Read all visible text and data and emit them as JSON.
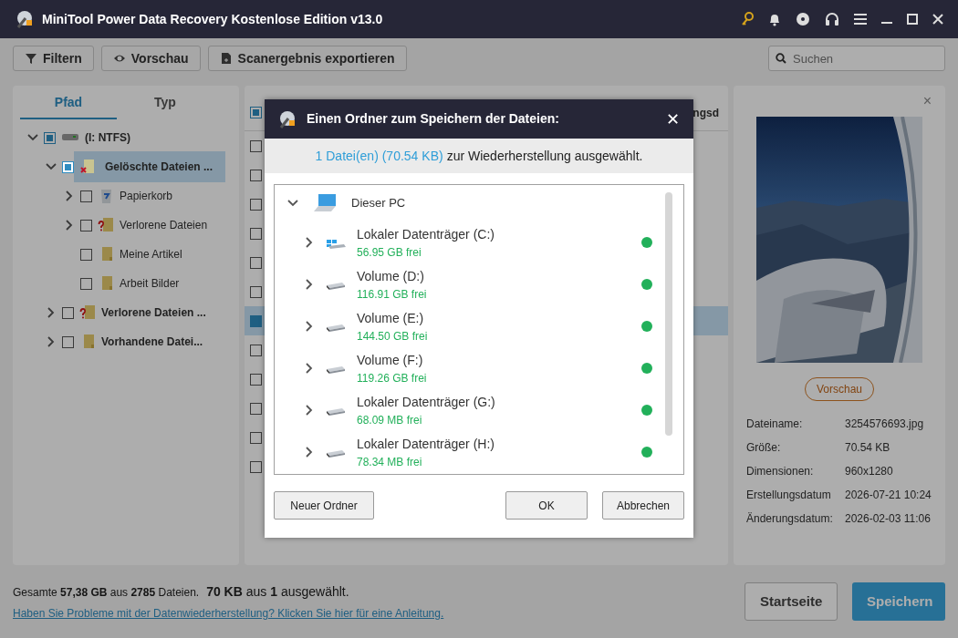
{
  "window": {
    "title": "MiniTool Power Data Recovery Kostenlose Edition v13.0"
  },
  "toolbar": {
    "buttons": [
      {
        "label": "Filtern",
        "kind": "filter"
      },
      {
        "label": "Vorschau",
        "kind": "eye"
      },
      {
        "label": "Scanergebnis exportieren",
        "kind": "export"
      }
    ],
    "search": {
      "placeholder": "Suchen"
    }
  },
  "tabs": [
    {
      "label": "Pfad",
      "selected": true
    },
    {
      "label": "Typ",
      "selected": false
    }
  ],
  "tree": [
    {
      "label": "(I: NTFS)",
      "kind": "drive",
      "checked": false,
      "partial": true,
      "selected": false,
      "expanded": true,
      "children": [
        {
          "label": "Gelöschte Dateien ...",
          "kind": "deleted",
          "checked": false,
          "partial": true,
          "selected": true,
          "expanded": true,
          "children": [
            {
              "label": "Papierkorb",
              "kind": "recycle",
              "checked": false,
              "partial": false,
              "selected": false,
              "expanded": false
            },
            {
              "label": "Verlorene Dateien",
              "kind": "lost",
              "checked": false,
              "partial": false,
              "selected": false,
              "expanded": false
            },
            {
              "label": "Meine Artikel",
              "kind": "folder",
              "checked": false,
              "partial": false,
              "selected": false
            },
            {
              "label": "Arbeit Bilder",
              "kind": "folder",
              "checked": false,
              "partial": false,
              "selected": false
            }
          ]
        },
        {
          "label": "Verlorene Dateien ...",
          "kind": "lost",
          "checked": false,
          "partial": false,
          "selected": false,
          "expanded": false
        },
        {
          "label": "Vorhandene Datei...",
          "kind": "folder",
          "checked": false,
          "partial": false,
          "selected": false,
          "expanded": false
        }
      ]
    }
  ],
  "file_list": {
    "header": {
      "checked": false,
      "partial": true,
      "column_label": "ngsd"
    },
    "rows": [
      {
        "checked": false,
        "selected": false
      },
      {
        "checked": false,
        "selected": false
      },
      {
        "checked": false,
        "selected": false
      },
      {
        "checked": false,
        "selected": false
      },
      {
        "checked": false,
        "selected": false
      },
      {
        "checked": false,
        "selected": false
      },
      {
        "checked": true,
        "selected": true
      },
      {
        "checked": false,
        "selected": false
      },
      {
        "checked": false,
        "selected": false
      },
      {
        "checked": false,
        "selected": false
      },
      {
        "checked": false,
        "selected": false
      },
      {
        "checked": false,
        "selected": false
      }
    ]
  },
  "preview": {
    "close": "×",
    "button": "Vorschau",
    "details": [
      {
        "label": "Dateiname:",
        "value": "3254576693.jpg"
      },
      {
        "label": "Größe:",
        "value": "70.54 KB"
      },
      {
        "label": "Dimensionen:",
        "value": "960x1280"
      },
      {
        "label": "Erstellungsdatum",
        "value": "2026-07-21 10:24"
      },
      {
        "label": "Änderungsdatum:",
        "value": "2026-02-03 11:06"
      }
    ]
  },
  "footer": {
    "summary": "Gesamte **57,38 GB** aus **2785** Dateien.",
    "selection": "**70 KB** aus **1** ausgewählt.",
    "help_link": "Haben Sie Probleme mit der Datenwiederherstellung? Klicken Sie hier für eine Anleitung.",
    "buttons": [
      {
        "label": "Startseite",
        "kind": "secondary"
      },
      {
        "label": "Speichern",
        "kind": "primary"
      }
    ]
  },
  "dialog": {
    "title": "Einen Ordner zum Speichern der Dateien:",
    "close": "✕",
    "count": "1 Datei(en) (70.54 KB)",
    "message": "zur Wiederherstellung ausgewählt.",
    "root": {
      "label": "Dieser PC",
      "expanded": true
    },
    "drives": [
      {
        "name": "Lokaler Datenträger (C:)",
        "free": "56.95 GB frei",
        "kind": "system",
        "expanded": false,
        "color": "#22b05a"
      },
      {
        "name": "Volume (D:)",
        "free": "116.91 GB frei",
        "kind": "disk",
        "expanded": false,
        "color": "#22b05a"
      },
      {
        "name": "Volume (E:)",
        "free": "144.50 GB frei",
        "kind": "disk",
        "expanded": false,
        "color": "#22b05a"
      },
      {
        "name": "Volume (F:)",
        "free": "119.26 GB frei",
        "kind": "disk",
        "expanded": false,
        "color": "#22b05a"
      },
      {
        "name": "Lokaler Datenträger (G:)",
        "free": "68.09 MB frei",
        "kind": "disk",
        "expanded": false,
        "color": "#22b05a"
      },
      {
        "name": "Lokaler Datenträger (H:)",
        "free": "78.34 MB frei",
        "kind": "disk",
        "expanded": false,
        "color": "#22b05a"
      }
    ],
    "buttons": [
      {
        "label": "Neuer Ordner",
        "kind": "left"
      },
      {
        "label": "OK",
        "kind": "right"
      },
      {
        "label": "Abbrechen",
        "kind": "right"
      }
    ]
  }
}
